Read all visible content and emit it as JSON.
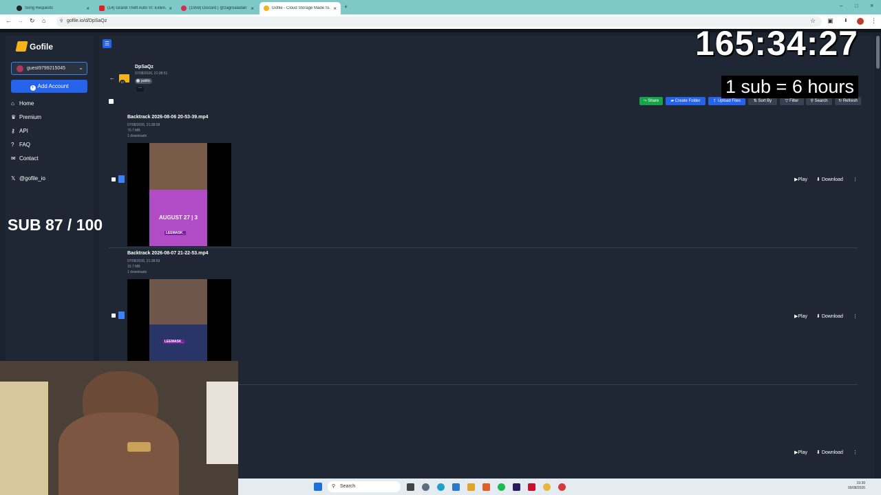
{
  "browser": {
    "tabs": [
      {
        "title": "Song Requests",
        "active": false
      },
      {
        "title": "(14) Grand Theft Auto VI: Exten...",
        "active": false
      },
      {
        "title": "(1959) Discord | @zagroaladan",
        "active": false
      },
      {
        "title": "Gofile - Cloud Storage Made Si...",
        "active": true
      }
    ],
    "url": "gofile.io/d/DpSaQz",
    "new_tab": "+"
  },
  "sidebar": {
    "brand": "Gofile",
    "account_name": "guest9799215045",
    "add_account": "Add Account",
    "nav": [
      {
        "label": "Home",
        "icon": "home-icon"
      },
      {
        "label": "Premium",
        "icon": "crown-icon"
      },
      {
        "label": "API",
        "icon": "key-icon"
      },
      {
        "label": "FAQ",
        "icon": "question-icon"
      },
      {
        "label": "Contact",
        "icon": "envelope-icon"
      }
    ],
    "social": "@gofile_io"
  },
  "overlay": {
    "timer": "165:34:27",
    "sub_info": "1 sub = 6 hours",
    "sub_count": "SUB 87 / 100"
  },
  "folder": {
    "name": "DpSaQz",
    "date": "07/08/2026, 21:38:51",
    "badge_count": "17",
    "visibility": "public",
    "more": "..."
  },
  "toolbar": {
    "share": "Share",
    "create_folder": "Create Folder",
    "upload_files": "Upload Files",
    "sort_by": "Sort By",
    "filter": "Filter",
    "search": "Search",
    "refresh": "Refresh"
  },
  "files": [
    {
      "name": "Backtrack 2026-08-06 20-53-39.mp4",
      "date": "07/08/2026, 21:38:58",
      "size": "70.7 MB",
      "downloads": "1 downloads",
      "thumb_text": "AUGUST 27 | 3",
      "thumb_sub": "LEEMASK_",
      "play": "Play",
      "download": "Download"
    },
    {
      "name": "Backtrack 2026-08-07 21-22-53.mp4",
      "date": "07/08/2026, 21:38:59",
      "size": "15.7 MB",
      "downloads": "1 downloads",
      "thumb_text": "",
      "thumb_sub": "LEEMASK_",
      "play": "Play",
      "download": "Download"
    },
    {
      "name": "",
      "date": "",
      "size": "",
      "downloads": "",
      "thumb_text": "",
      "thumb_sub": "",
      "play": "Play",
      "download": "Download"
    }
  ],
  "taskbar": {
    "search_placeholder": "Search",
    "time": "19:39",
    "date": "09/08/2026"
  },
  "colors": {
    "bg": "#1a222d",
    "panel": "#1e2733",
    "primary": "#2563eb",
    "share_green": "#16a34a",
    "brand_yellow": "#f5b31b",
    "tab_bar": "#7fc8c8"
  }
}
